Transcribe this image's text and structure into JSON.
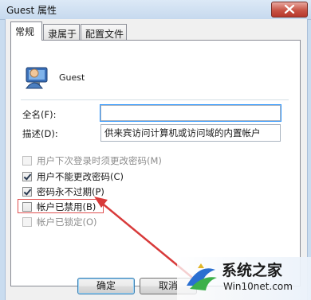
{
  "window": {
    "title": "Guest 属性"
  },
  "tabs": [
    {
      "label": "常规"
    },
    {
      "label": "隶属于"
    },
    {
      "label": "配置文件"
    }
  ],
  "user": {
    "name": "Guest"
  },
  "form": {
    "fullname_label": "全名(F):",
    "fullname_value": "",
    "description_label": "描述(D):",
    "description_value": "供来宾访问计算机或访问域的内置帐户"
  },
  "options": [
    {
      "label": "用户下次登录时须更改密码(M)",
      "checked": false,
      "enabled": false
    },
    {
      "label": "用户不能更改密码(C)",
      "checked": true,
      "enabled": true
    },
    {
      "label": "密码永不过期(P)",
      "checked": true,
      "enabled": true
    },
    {
      "label": "帐户已禁用(B)",
      "checked": false,
      "enabled": true
    },
    {
      "label": "帐户已锁定(O)",
      "checked": false,
      "enabled": false
    }
  ],
  "buttons": {
    "ok": "确定",
    "cancel": "取消"
  },
  "watermark": {
    "text": "系统之家",
    "url": "Win10net.com"
  },
  "colors": {
    "highlight": "#e05050",
    "arrow": "#d83a3a"
  }
}
